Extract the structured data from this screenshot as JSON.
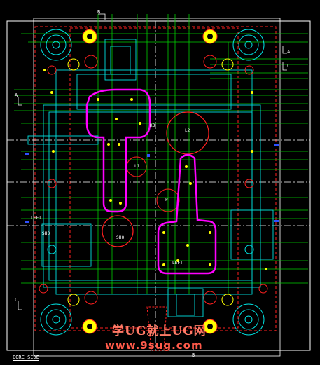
{
  "drawing": {
    "title": "CORE SIDE",
    "section_marks": [
      "B",
      "B",
      "A",
      "A",
      "C",
      "C"
    ],
    "labels": [
      "L2",
      "L1",
      "LEFT",
      "LEFT",
      "KO",
      "P",
      "SHO",
      "SHO"
    ],
    "watermark_cn": "学UG就上UG网",
    "watermark_url": "www.9sug.com"
  },
  "colors": {
    "background": "#000000",
    "outline": "#ffffff",
    "green": "#00d000",
    "red": "#ff2020",
    "cyan": "#00e0e0",
    "magenta": "#ff00ff",
    "yellow": "#ffff00",
    "blue": "#3050ff"
  }
}
